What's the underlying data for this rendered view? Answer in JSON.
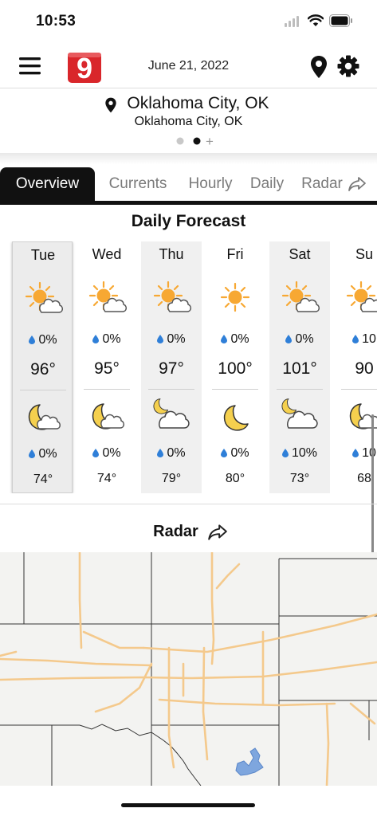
{
  "status_bar": {
    "time": "10:53"
  },
  "header": {
    "date": "June 21, 2022",
    "logo_text": "9"
  },
  "location": {
    "name": "Oklahoma City, OK",
    "subtitle": "Oklahoma City, OK",
    "page_plus": "+"
  },
  "tabs": [
    {
      "label": "Overview",
      "active": true
    },
    {
      "label": "Currents"
    },
    {
      "label": "Hourly"
    },
    {
      "label": "Daily"
    },
    {
      "label": "Radar"
    }
  ],
  "forecast": {
    "title": "Daily Forecast",
    "days": [
      {
        "day": "Tue",
        "day_icon": "partly-sunny-icon",
        "day_precip": "0%",
        "high": "96°",
        "night_icon": "partly-cloudy-night-icon",
        "night_precip": "0%",
        "low": "74°"
      },
      {
        "day": "Wed",
        "day_icon": "partly-sunny-icon",
        "day_precip": "0%",
        "high": "95°",
        "night_icon": "partly-cloudy-night-icon",
        "night_precip": "0%",
        "low": "74°"
      },
      {
        "day": "Thu",
        "day_icon": "partly-sunny-icon",
        "day_precip": "0%",
        "high": "97°",
        "night_icon": "mostly-cloudy-night-icon",
        "night_precip": "0%",
        "low": "79°"
      },
      {
        "day": "Fri",
        "day_icon": "sunny-icon",
        "day_precip": "0%",
        "high": "100°",
        "night_icon": "clear-night-icon",
        "night_precip": "0%",
        "low": "80°"
      },
      {
        "day": "Sat",
        "day_icon": "partly-sunny-icon",
        "day_precip": "0%",
        "high": "101°",
        "night_icon": "mostly-cloudy-night-icon",
        "night_precip": "10%",
        "low": "73°"
      },
      {
        "day": "Su",
        "day_icon": "partly-sunny-icon",
        "day_precip": "10",
        "high": "90",
        "night_icon": "partly-cloudy-night-icon",
        "night_precip": "10",
        "low": "68"
      }
    ]
  },
  "radar": {
    "title": "Radar"
  },
  "colors": {
    "sun": "#f7a833",
    "moon": "#f5d04e",
    "drop": "#2f7fd8",
    "road": "#f4c98c",
    "water": "#7ea6de",
    "logo": "#d9262b"
  }
}
